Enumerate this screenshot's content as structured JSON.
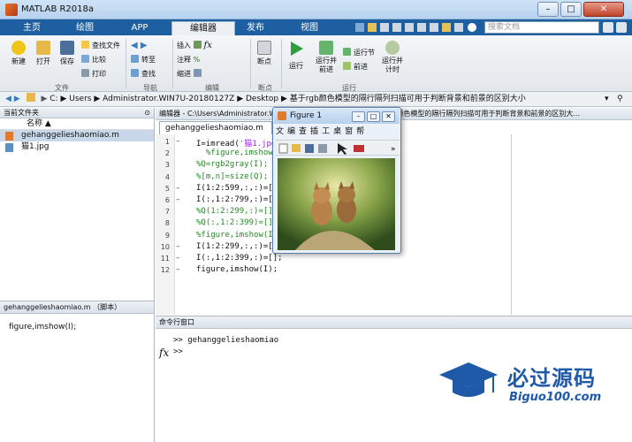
{
  "window": {
    "title": "MATLAB R2018a",
    "buttons": [
      "–",
      "□",
      "✕"
    ]
  },
  "tabs": [
    {
      "label": "主页"
    },
    {
      "label": "绘图"
    },
    {
      "label": "APP"
    },
    {
      "label": "编辑器",
      "active": true
    },
    {
      "label": "发布"
    },
    {
      "label": "视图"
    }
  ],
  "search": {
    "placeholder": "搜索文档"
  },
  "ribbon": {
    "file": {
      "new": "新建",
      "open": "打开",
      "save": "保存",
      "find_files": "查找文件",
      "compare": "比较",
      "print": "打印",
      "group": "文件"
    },
    "navigate": {
      "goto": "转至",
      "find": "查找",
      "group": "导航"
    },
    "edit": {
      "insert": "插入",
      "comment": "注释",
      "indent": "缩进",
      "group": "编辑"
    },
    "breakpoints": {
      "label": "断点",
      "group": "断点"
    },
    "run": {
      "run": "运行",
      "run_advance": "运行并前进",
      "run_section": "运行节",
      "advance": "前进",
      "run_time": "运行并计时",
      "group": "运行"
    }
  },
  "address": {
    "parts": [
      "C:",
      "Users",
      "Administrator.WIN7U-20180127Z",
      "Desktop",
      "基于rgb颜色模型的隔行隔列扫描可用于判断背景和前景的区别大小"
    ]
  },
  "current_folder": {
    "title": "当前文件夹",
    "column": "名称 ▲",
    "files": [
      {
        "name": "gehanggelieshaomiao.m",
        "selected": true
      },
      {
        "name": "猫1.jpg",
        "selected": false
      }
    ]
  },
  "details": {
    "title": "gehanggelieshaomiao.m （脚本）",
    "content": "figure,imshow(I);"
  },
  "editor": {
    "title": "编辑器 - C:\\Users\\Administrator.WIN7U-20180127Z\\Desktop\\基于rgb颜色模型的隔行隔列扫描可用于判断背景和前景的区别大...",
    "tab": "gehanggelieshaomiao.m",
    "lines": [
      {
        "n": "1",
        "dash": true,
        "a": "I=imread(",
        "s": "'猫1.jpg'",
        "b": ");",
        "type": "str"
      },
      {
        "n": "2",
        "dash": false,
        "text": "  %figure,imshow(I);",
        "type": "cmt"
      },
      {
        "n": "3",
        "dash": false,
        "text": "%Q=rgb2gray(I);",
        "type": "cmt"
      },
      {
        "n": "4",
        "dash": false,
        "text": "%[m,n]=size(Q);",
        "type": "cmt"
      },
      {
        "n": "5",
        "dash": true,
        "text": "I(1:2:599,:,:)=[];",
        "type": "code"
      },
      {
        "n": "6",
        "dash": true,
        "text": "I(:,1:2:799,:)=[];",
        "type": "code"
      },
      {
        "n": "7",
        "dash": false,
        "text": "%Q(1:2:299,:)=[];",
        "type": "cmt"
      },
      {
        "n": "8",
        "dash": false,
        "text": "%Q(:,1:2:399)=[];",
        "type": "cmt"
      },
      {
        "n": "9",
        "dash": false,
        "text": "%figure,imshow(I);",
        "type": "cmt"
      },
      {
        "n": "10",
        "dash": true,
        "text": "I(1:2:299,:,:)=[];",
        "type": "code"
      },
      {
        "n": "11",
        "dash": true,
        "text": "I(:,1:2:399,:)=[];",
        "type": "code"
      },
      {
        "n": "12",
        "dash": true,
        "text": "figure,imshow(I);",
        "type": "code"
      }
    ]
  },
  "figure": {
    "title": "Figure 1",
    "menu": [
      "文",
      "编",
      "查",
      "插",
      "工",
      "桌",
      "窗",
      "帮"
    ]
  },
  "command_window": {
    "title": "命令行窗口",
    "lines": [
      ">> gehanggelieshaomiao",
      ">>"
    ],
    "fx": "fx"
  },
  "watermark": {
    "cn": "必过源码",
    "en": "Biguo100.com"
  },
  "colors": {
    "tabbar": "#1d5fa0",
    "ribbon": "#eceff3",
    "comment": "#228b22",
    "string": "#a020f0"
  }
}
